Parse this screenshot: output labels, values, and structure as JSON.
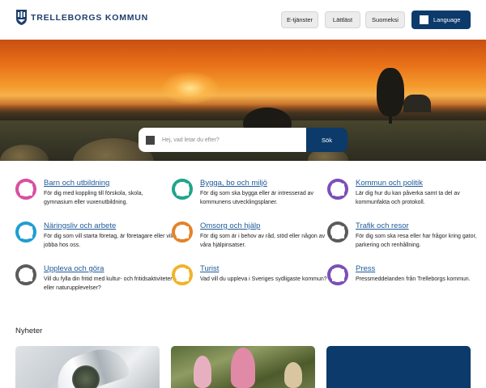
{
  "header": {
    "logo_text": "TRELLEBORGS KOMMUN",
    "buttons": [
      "E-tjänster",
      "Lättläst",
      "Suomeksi"
    ],
    "language_label": "Language"
  },
  "hero": {
    "search_placeholder": "Hej, vad letar du efter?",
    "search_button": "Sök"
  },
  "categories": [
    {
      "title": "Barn och utbildning",
      "desc": "För dig med koppling till förskola, skola, gymnasium eller vuxenutbildning.",
      "color": "#d94fa3"
    },
    {
      "title": "Bygga, bo och miljö",
      "desc": "För dig som ska bygga eller är intresserad av kommunens utvecklingsplaner.",
      "color": "#1fa58a"
    },
    {
      "title": "Kommun och politik",
      "desc": "Lär dig hur du kan påverka samt ta del av kommunfakta och protokoll.",
      "color": "#7b4fb8"
    },
    {
      "title": "Näringsliv och arbete",
      "desc": "För dig som vill starta företag, är företagare eller vill jobba hos oss.",
      "color": "#1e9ed1"
    },
    {
      "title": "Omsorg och hjälp",
      "desc": "För dig som är i behov av råd, stöd eller någon av våra hjälpinsatser.",
      "color": "#e3832a"
    },
    {
      "title": "Trafik och resor",
      "desc": "För dig som ska resa eller har frågor kring gator, parkering och renhållning.",
      "color": "#5b5b5b"
    },
    {
      "title": "Uppleva och göra",
      "desc": "Vill du fylla din fritid med kultur- och fritidsaktiviteter eller naturupplevelser?",
      "color": "#5b5b5b"
    },
    {
      "title": "Turist",
      "desc": "Vad vill du uppleva i Sveriges sydligaste kommun?",
      "color": "#f0b429"
    },
    {
      "title": "Press",
      "desc": "Pressmeddelanden från Trelleborgs kommun.",
      "color": "#7b4fb8"
    }
  ],
  "news": {
    "title": "Nyheter"
  },
  "colors": {
    "brand_navy": "#0b3a6b",
    "link": "#1f5a9a"
  }
}
